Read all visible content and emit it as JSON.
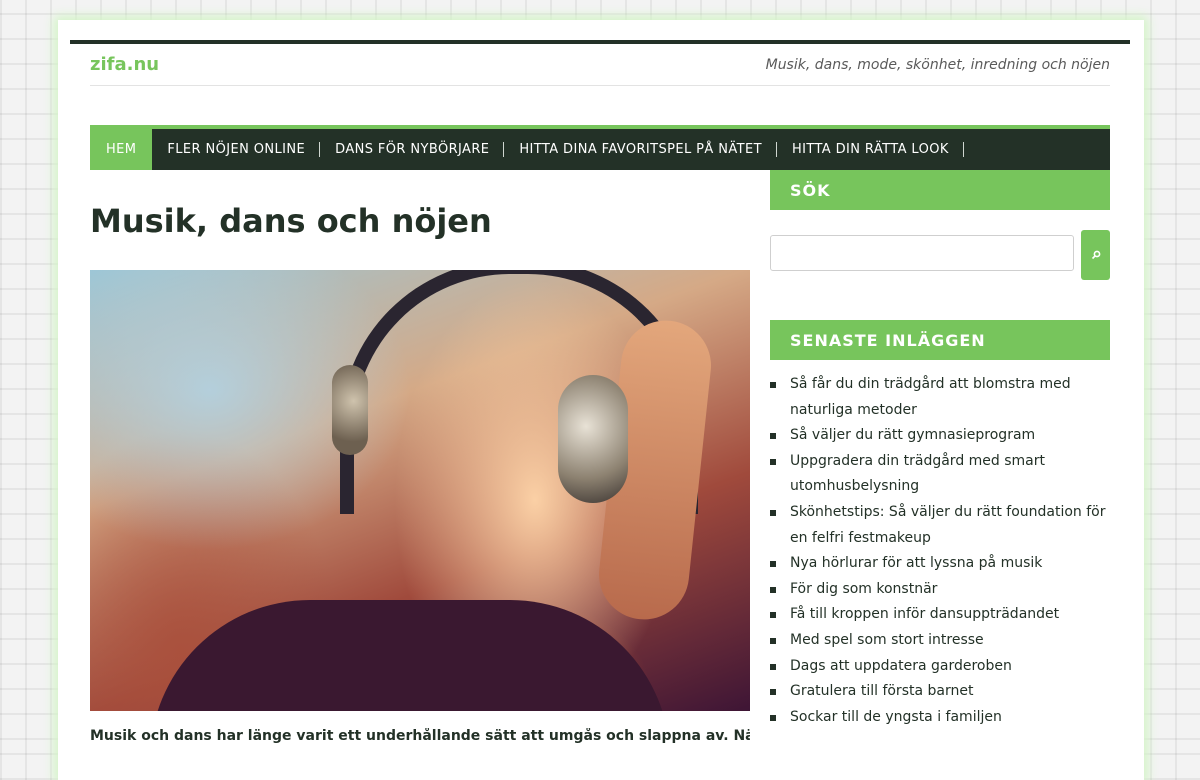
{
  "site": {
    "title": "zifa.nu",
    "tagline": "Musik, dans, mode, skönhet, inredning och nöjen"
  },
  "nav": {
    "items": [
      {
        "label": "Hem"
      },
      {
        "label": "Fler nöjen online"
      },
      {
        "label": "Dans för nybörjare"
      },
      {
        "label": "Hitta dina favoritspel på nätet"
      },
      {
        "label": "Hitta din rätta look"
      }
    ]
  },
  "post": {
    "title": "Musik, dans och nöjen",
    "excerpt": "Musik och dans har länge varit ett underhållande sätt att umgås och slappna av. Nästan alla har"
  },
  "sidebar": {
    "search": {
      "title": "Sök",
      "placeholder": "",
      "icon": "search-icon"
    },
    "recent": {
      "title": "Senaste inläggen",
      "items": [
        "Så får du din trädgård att blomstra med naturliga metoder",
        "Så väljer du rätt gymnasieprogram",
        "Uppgradera din trädgård med smart utomhusbelysning",
        "Skönhetstips: Så väljer du rätt foundation för en felfri festmakeup",
        "Nya hörlurar för att lyssna på musik",
        "För dig som konstnär",
        "Få till kroppen inför dansuppträdandet",
        "Med spel som stort intresse",
        "Dags att uppdatera garderoben",
        "Gratulera till första barnet",
        "Sockar till de yngsta i familjen"
      ]
    }
  },
  "colors": {
    "accent": "#77c55c",
    "dark": "#233127"
  }
}
